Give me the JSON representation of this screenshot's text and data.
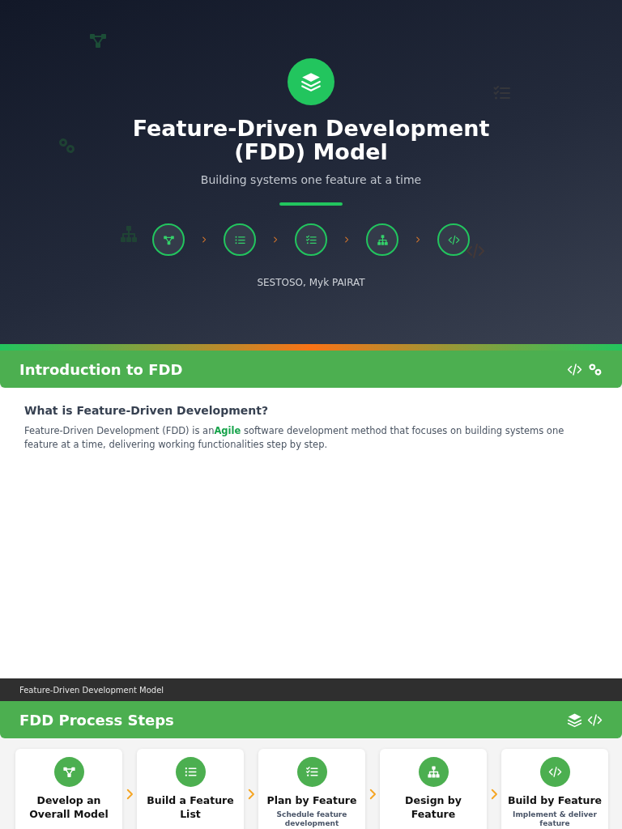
{
  "hero": {
    "title": "Feature-Driven Development (FDD) Model",
    "subtitle": "Building systems one feature at a time",
    "author": "SESTOSO, Myk PAIRAT"
  },
  "intro": {
    "title": "Introduction to FDD",
    "heading": "What is Feature-Driven Development?",
    "text": "Feature-Driven Development (FDD) is an**Agile** software development method that focuses on building systems one feature at a time, delivering working functionalities step by step."
  },
  "footer_bar": {
    "text": "Feature-Driven Development Model"
  },
  "steps_section": {
    "title": "FDD Process Steps",
    "steps": [
      {
        "title": "Develop an Overall Model"
      },
      {
        "title": "Build a Feature List"
      },
      {
        "title": "Plan by Feature",
        "description": "Schedule feature development"
      },
      {
        "title": "Design by Feature"
      },
      {
        "title": "Build by Feature",
        "description": "Implement & deliver feature"
      }
    ]
  }
}
